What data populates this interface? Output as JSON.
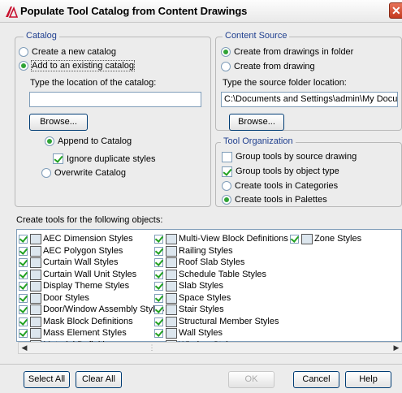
{
  "window": {
    "title": "Populate Tool Catalog from Content Drawings",
    "close_glyph": "✕"
  },
  "catalog": {
    "legend": "Catalog",
    "create_new": "Create a new catalog",
    "add_existing": "Add to an existing catalog",
    "location_label": "Type the location of the catalog:",
    "location_value": "",
    "browse": "Browse...",
    "append": "Append to Catalog",
    "ignore_duplicates": "Ignore duplicate styles",
    "overwrite": "Overwrite Catalog"
  },
  "content_source": {
    "legend": "Content Source",
    "from_folder": "Create from drawings in folder",
    "from_drawing": "Create from drawing",
    "folder_label": "Type the source folder location:",
    "folder_value": "C:\\Documents and Settings\\admin\\My Documents",
    "browse": "Browse..."
  },
  "tool_org": {
    "legend": "Tool Organization",
    "group_by_drawing": "Group tools by source drawing",
    "group_by_type": "Group tools by object type",
    "in_categories": "Create tools in Categories",
    "in_palettes": "Create tools in Palettes"
  },
  "objects": {
    "label": "Create tools for the following objects:",
    "col1": [
      "AEC Dimension Styles",
      "AEC Polygon Styles",
      "Curtain Wall Styles",
      "Curtain Wall Unit Styles",
      "Display Theme Styles",
      "Door Styles",
      "Door/Window Assembly Styles",
      "Mask Block Definitions",
      "Mass Element Styles",
      "Material Definitions"
    ],
    "col2": [
      "Multi-View Block Definitions",
      "Railing Styles",
      "Roof Slab Styles",
      "Schedule Table Styles",
      "Slab Styles",
      "Space Styles",
      "Stair Styles",
      "Structural Member Styles",
      "Wall Styles",
      "Window Styles"
    ],
    "col3": [
      "Zone Styles"
    ]
  },
  "scrollbar": {
    "left_glyph": "◀",
    "right_glyph": "▶",
    "grip": "⋮"
  },
  "buttons": {
    "select_all": "Select All",
    "clear_all": "Clear All",
    "ok": "OK",
    "cancel": "Cancel",
    "help": "Help"
  }
}
